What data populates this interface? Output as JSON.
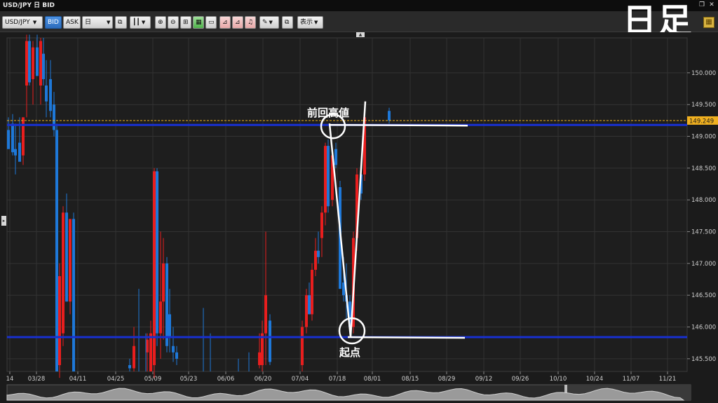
{
  "window": {
    "title": "USD/JPY 日 BID",
    "controls": [
      "restore-icon",
      "close-icon"
    ]
  },
  "toolbar": {
    "symbol": "USD/JPY",
    "bid_label": "BID",
    "ask_label": "ASK",
    "period": "日",
    "display_label": "表示",
    "overlay_title": "日足"
  },
  "chart_data": {
    "type": "candlestick",
    "symbol": "USD/JPY",
    "price_axis": {
      "min": 145.3,
      "max": 150.55,
      "ticks": [
        "150.000",
        "149.500",
        "149.000",
        "148.500",
        "148.000",
        "147.500",
        "147.000",
        "146.500",
        "146.000",
        "145.500"
      ],
      "tick_values": [
        150.0,
        149.5,
        149.0,
        148.5,
        148.0,
        147.5,
        147.0,
        146.5,
        146.0,
        145.5
      ]
    },
    "date_axis": {
      "labels": [
        "14",
        "03/28",
        "04/11",
        "04/25",
        "05/09",
        "05/23",
        "06/06",
        "06/20",
        "07/04",
        "07/18",
        "08/01",
        "08/15",
        "08/29",
        "09/12",
        "09/26",
        "10/10",
        "10/24",
        "11/07",
        "11/21"
      ]
    },
    "current_price": {
      "value": 149.249,
      "label": "149.249",
      "color": "#f0b020"
    },
    "levels": [
      {
        "name": "prev-high-line",
        "value": 149.18,
        "color": "#1830d0"
      },
      {
        "name": "start-line",
        "value": 145.84,
        "color": "#1830d0"
      }
    ],
    "annotations": [
      {
        "text": "前回高値",
        "price": 149.18
      },
      {
        "text": "起点",
        "price": 145.84
      }
    ],
    "colors": {
      "up": "#e81e1e",
      "down": "#1e78d8",
      "grid": "#333333",
      "background": "#1b1b1b"
    }
  }
}
